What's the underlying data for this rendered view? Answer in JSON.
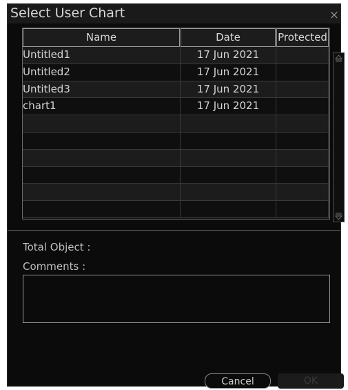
{
  "dialog": {
    "title": "Select User Chart",
    "close_label": "×"
  },
  "table": {
    "columns": [
      "Name",
      "Date",
      "Protected"
    ],
    "rows": [
      {
        "name": "Untitled1",
        "date": "17 Jun 2021",
        "protected": ""
      },
      {
        "name": "Untitled2",
        "date": "17 Jun 2021",
        "protected": ""
      },
      {
        "name": "Untitled3",
        "date": "17 Jun 2021",
        "protected": ""
      },
      {
        "name": "chart1",
        "date": "17 Jun 2021",
        "protected": ""
      },
      {
        "name": "",
        "date": "",
        "protected": ""
      },
      {
        "name": "",
        "date": "",
        "protected": ""
      },
      {
        "name": "",
        "date": "",
        "protected": ""
      },
      {
        "name": "",
        "date": "",
        "protected": ""
      },
      {
        "name": "",
        "date": "",
        "protected": ""
      },
      {
        "name": "",
        "date": "",
        "protected": ""
      }
    ]
  },
  "info": {
    "total_object_label": "Total Object :",
    "comments_label": "Comments :",
    "comments_value": ""
  },
  "buttons": {
    "cancel_label": "Cancel",
    "ok_label": "OK"
  }
}
